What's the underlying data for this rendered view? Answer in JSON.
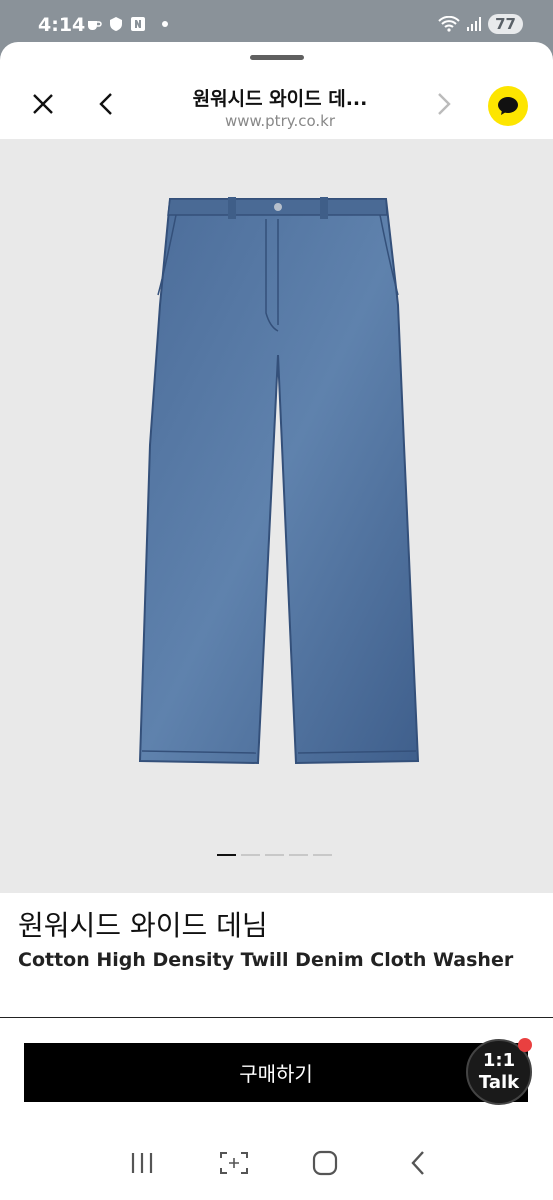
{
  "status": {
    "time": "4:14",
    "battery": "77"
  },
  "header": {
    "title": "원워시드 와이드 데...",
    "url": "www.ptry.co.kr"
  },
  "gallery": {
    "image_label": "denim-jeans-image",
    "slide_count": 5,
    "active_slide": 1
  },
  "product": {
    "name_ko": "원워시드 와이드 데님",
    "name_en": "Cotton High Density Twill Denim Cloth Washer"
  },
  "actions": {
    "buy_label": "구매하기",
    "chat_line1": "1:1",
    "chat_line2": "Talk"
  },
  "colors": {
    "accent_yellow": "#fde500",
    "buy_button": "#000000",
    "badge": "#e94040"
  }
}
